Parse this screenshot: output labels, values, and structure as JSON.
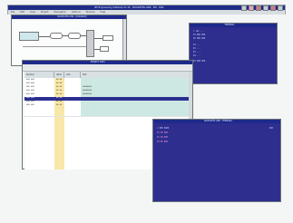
{
  "app": {
    "title": "IPS Engineering Software V1.30 · NAVIDATES-LINK · IPR · ENG",
    "menu": [
      "File",
      "Edit",
      "View",
      "Project",
      "Navigation",
      "Options",
      "Window",
      "Help"
    ]
  },
  "windows": {
    "diagram": {
      "title": "NAVIDATES LINK - [DIAGRAM]"
    },
    "console_right": {
      "title": "TERMINAL",
      "lines": [
        "> set ...",
        "01  000 000",
        "02  000 000",
        "  01  ...",
        "  02  ...",
        "  03  ...",
        "  04  ...",
        "05  000 000"
      ]
    },
    "table": {
      "title": "PROJECT DATA",
      "columns": [
        "Number",
        "Value",
        "Unit",
        "Text"
      ],
      "rows": [
        {
          "a": "000  000",
          "b": "00 00",
          "c": "",
          "d": ""
        },
        {
          "a": "000  000",
          "b": "00 00",
          "c": "",
          "d": ""
        },
        {
          "a": "000  000",
          "b": "00 00",
          "c": "00000000",
          "d": ""
        },
        {
          "a": "000  000",
          "b": "00 00",
          "c": "00000000",
          "d": ""
        },
        {
          "a": "000  000",
          "b": "00 00",
          "c": "00000000",
          "d": ""
        },
        {
          "a": "000  000",
          "b": "00 00",
          "c": "",
          "d": ""
        },
        {
          "a": "000  000",
          "b": "00 00",
          "c": "",
          "d": ""
        },
        {
          "a": "000  000",
          "b": "00 00",
          "c": "",
          "d": ""
        }
      ]
    },
    "console_bottom": {
      "title": "NAVIDATES LINK - TERMINAL",
      "lines": [
        "> 000 0000",
        "01 00 000",
        "02 00 000",
        "03 00 000"
      ],
      "badge": "000"
    }
  }
}
